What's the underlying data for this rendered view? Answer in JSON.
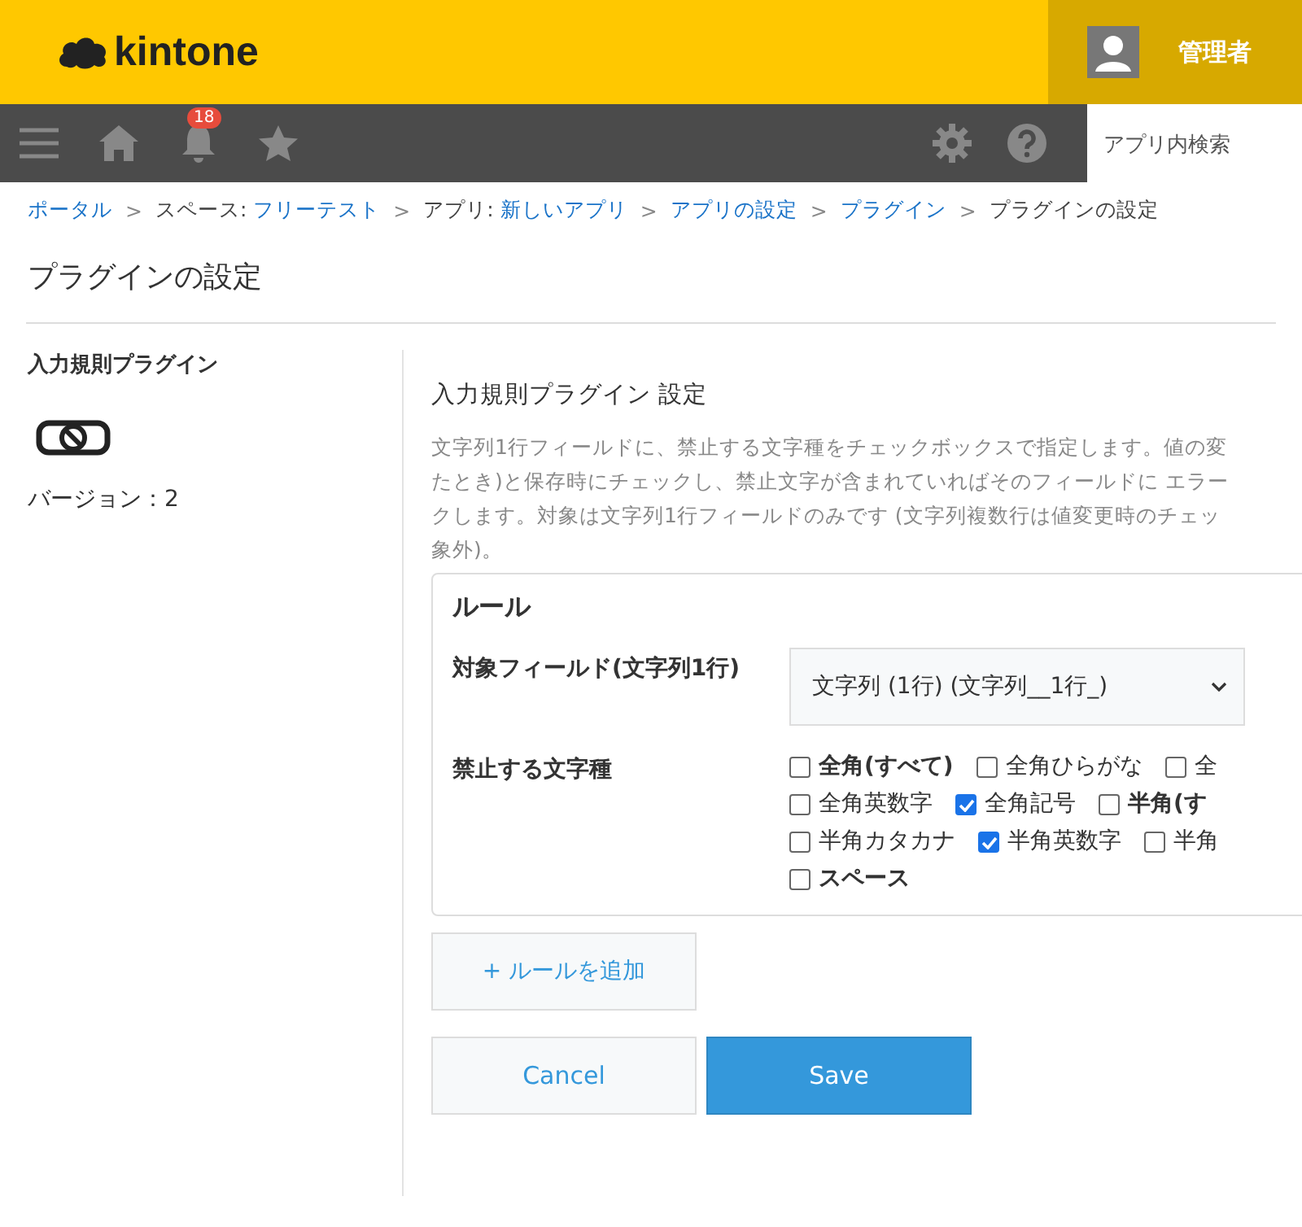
{
  "header": {
    "logo": "kintone",
    "user": "管理者"
  },
  "navbar": {
    "notification_count": "18",
    "search": {
      "placeholder": "アプリ内検索"
    }
  },
  "breadcrumb": [
    {
      "label": "ポータル",
      "link": true
    },
    {
      "label": "スペース: ",
      "link": false
    },
    {
      "label": "フリーテスト",
      "link": true
    },
    {
      "label": "アプリ: ",
      "link": false
    },
    {
      "label": "新しいアプリ",
      "link": true
    },
    {
      "label": "アプリの設定",
      "link": true
    },
    {
      "label": "プラグイン",
      "link": true
    },
    {
      "label": "プラグインの設定",
      "link": false
    }
  ],
  "breadcrumb_separators": [
    ">",
    ">",
    ">",
    ">",
    ">"
  ],
  "page_title": "プラグインの設定",
  "sidebar": {
    "plugin_name": "入力規則プラグイン",
    "version": "バージョン：2"
  },
  "settings": {
    "title": "入力規則プラグイン 設定",
    "description": [
      "文字列1行フィールドに、禁止する文字種をチェックボックスで指定します。値の変",
      "たとき)と保存時にチェックし、禁止文字が含まれていればそのフィールドに エラー",
      "クします。対象は文字列1行フィールドのみです (文字列複数行は値変更時のチェッ",
      "象外)。"
    ],
    "rule": {
      "heading": "ルール",
      "field_label": "対象フィールド(文字列1行)",
      "field_value": "文字列 (1行) (文字列__1行_)",
      "types_label": "禁止する文字種",
      "rows": [
        [
          {
            "label": "全角(すべて)",
            "bold": true,
            "checked": false
          },
          {
            "label": "全角ひらがな",
            "bold": false,
            "checked": false
          },
          {
            "label": "全",
            "bold": false,
            "checked": false
          }
        ],
        [
          {
            "label": "全角英数字",
            "bold": false,
            "checked": false
          },
          {
            "label": "全角記号",
            "bold": false,
            "checked": true
          },
          {
            "label": "半角(す",
            "bold": true,
            "checked": false
          }
        ],
        [
          {
            "label": "半角カタカナ",
            "bold": false,
            "checked": false
          },
          {
            "label": "半角英数字",
            "bold": false,
            "checked": true
          },
          {
            "label": "半角",
            "bold": false,
            "checked": false
          }
        ],
        [
          {
            "label": "スペース",
            "bold": true,
            "checked": false
          }
        ]
      ]
    },
    "add_rule": "+ ルールを追加",
    "cancel": "Cancel",
    "save": "Save"
  }
}
